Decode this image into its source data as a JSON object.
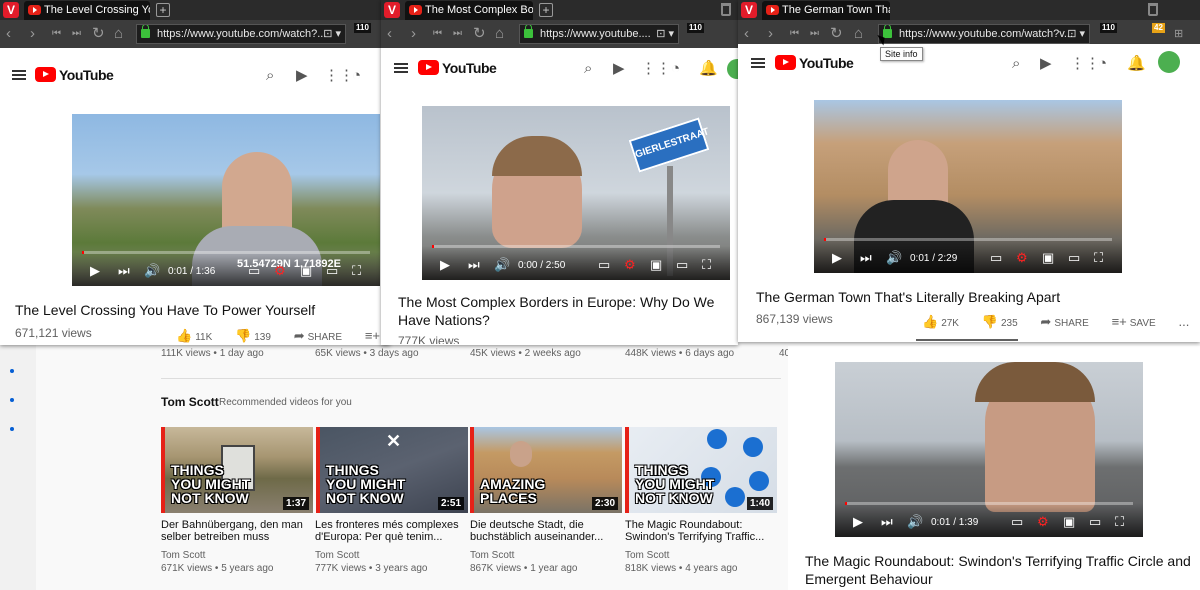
{
  "windows": [
    {
      "tab_title": "The Level Crossing You Have To Power Yourself",
      "tab_short": "The Level Crossing You Hav",
      "url": "https://www.youtube.com/watch?...",
      "extension_badge": "110",
      "video_time": "0:01 / 1:36",
      "overlay_text": "51.54729N 1.71892E",
      "title": "The Level Crossing You Have To Power Yourself",
      "views": "671,121 views",
      "likes": "11K",
      "dislikes": "139",
      "share_label": "SHARE",
      "save_label": "SA"
    },
    {
      "tab_title": "The Most Complex Borders in Europe",
      "tab_short": "The Most Complex Borders",
      "url": "https://www.youtube....",
      "extension_badge": "110",
      "video_time": "0:00 / 2:50",
      "sign_text": "GIERLESTRAAT",
      "title": "The Most Complex Borders in Europe: Why Do We Have Nations?",
      "views": "777K views"
    },
    {
      "tab_title": "The German Town That's Literally Breaking Apart",
      "tab_short": "The German Town That's Lit",
      "url": "https://www.youtube.com/watch?v...",
      "extension_badge": "110",
      "notif_badge": "42",
      "tooltip": "Site info",
      "video_time": "0:01 / 2:29",
      "title": "The German Town That's Literally Breaking Apart",
      "views": "867,139 views",
      "likes": "27K",
      "dislikes": "235",
      "share_label": "SHARE",
      "save_label": "SAVE",
      "more": "..."
    }
  ],
  "behind_row": [
    "111K views • 1 day ago",
    "65K views • 3 days ago",
    "45K views • 2 weeks ago",
    "448K views • 6 days ago",
    "40"
  ],
  "section": {
    "channel": "Tom Scott",
    "subtitle": "Recommended videos for you"
  },
  "recommended": [
    {
      "overlay": [
        "THINGS",
        "YOU MIGHT",
        "NOT KNOW"
      ],
      "duration": "1:37",
      "title": "Der Bahnübergang, den man selber betreiben muss",
      "channel": "Tom Scott",
      "meta": "671K views • 5 years ago"
    },
    {
      "overlay": [
        "THINGS",
        "YOU MIGHT",
        "NOT KNOW"
      ],
      "duration": "2:51",
      "title": "Les fronteres més complexes d'Europa: Per què tenim...",
      "channel": "Tom Scott",
      "meta": "777K views • 3 years ago"
    },
    {
      "overlay": [
        "AMAZING",
        "PLACES"
      ],
      "duration": "2:30",
      "title": "Die deutsche Stadt, die buchstäblich auseinander...",
      "channel": "Tom Scott",
      "meta": "867K views • 1 year ago"
    },
    {
      "overlay": [
        "THINGS",
        "YOU MIGHT",
        "NOT KNOW"
      ],
      "duration": "1:40",
      "title": "The Magic Roundabout: Swindon's Terrifying Traffic...",
      "channel": "Tom Scott",
      "meta": "818K views • 4 years ago"
    }
  ],
  "bottom_right": {
    "video_time": "0:01 / 1:39",
    "title": "The Magic Roundabout: Swindon's Terrifying Traffic Circle and Emergent Behaviour"
  },
  "colors": {
    "youtube_red": "#ff0000",
    "vivaldi_red": "#e21c2a",
    "lock_green": "#3cc13b"
  }
}
